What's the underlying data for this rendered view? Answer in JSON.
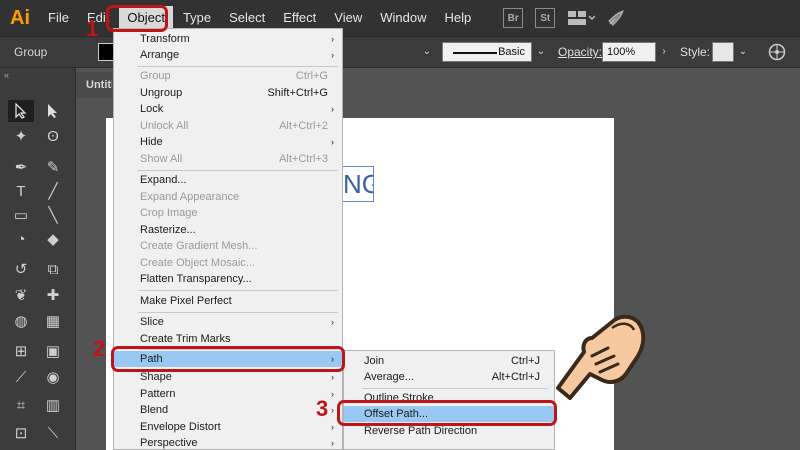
{
  "app": {
    "logo": "Ai"
  },
  "menubar": {
    "items": [
      "File",
      "Edit",
      "Object",
      "Type",
      "Select",
      "Effect",
      "View",
      "Window",
      "Help"
    ],
    "active": "Object",
    "icons": {
      "bridge": "Br",
      "stock": "St"
    }
  },
  "controlbar": {
    "selection_label": "Group",
    "stroke_style": "Basic",
    "opacity_label": "Opacity:",
    "opacity_value": "100%",
    "style_label": "Style:"
  },
  "document": {
    "tab_title": "Untitled",
    "canvas_text": "NG"
  },
  "object_menu": [
    {
      "label": "Transform",
      "submenu": true
    },
    {
      "label": "Arrange",
      "submenu": true
    },
    {
      "separator": true
    },
    {
      "label": "Group",
      "shortcut": "Ctrl+G",
      "disabled": true
    },
    {
      "label": "Ungroup",
      "shortcut": "Shift+Ctrl+G"
    },
    {
      "label": "Lock",
      "submenu": true
    },
    {
      "label": "Unlock All",
      "shortcut": "Alt+Ctrl+2",
      "disabled": true
    },
    {
      "label": "Hide",
      "submenu": true
    },
    {
      "label": "Show All",
      "shortcut": "Alt+Ctrl+3",
      "disabled": true
    },
    {
      "separator": true
    },
    {
      "label": "Expand..."
    },
    {
      "label": "Expand Appearance",
      "disabled": true
    },
    {
      "label": "Crop Image",
      "disabled": true
    },
    {
      "label": "Rasterize..."
    },
    {
      "label": "Create Gradient Mesh...",
      "disabled": true
    },
    {
      "label": "Create Object Mosaic...",
      "disabled": true
    },
    {
      "label": "Flatten Transparency..."
    },
    {
      "separator": true
    },
    {
      "label": "Make Pixel Perfect"
    },
    {
      "separator": true
    },
    {
      "label": "Slice",
      "submenu": true
    },
    {
      "label": "Create Trim Marks"
    },
    {
      "separator": true
    },
    {
      "label": "Path",
      "submenu": true,
      "highlighted": true
    },
    {
      "label": "Shape",
      "submenu": true
    },
    {
      "label": "Pattern",
      "submenu": true
    },
    {
      "label": "Blend",
      "submenu": true
    },
    {
      "label": "Envelope Distort",
      "submenu": true
    },
    {
      "label": "Perspective",
      "submenu": true
    }
  ],
  "path_submenu": [
    {
      "label": "Join",
      "shortcut": "Ctrl+J"
    },
    {
      "label": "Average...",
      "shortcut": "Alt+Ctrl+J"
    },
    {
      "separator": true
    },
    {
      "label": "Outline Stroke"
    },
    {
      "label": "Offset Path...",
      "highlighted": true
    },
    {
      "label": "Reverse Path Direction"
    }
  ],
  "annotations": {
    "step1": "1",
    "step2": "2",
    "step3": "3"
  },
  "colors": {
    "highlight": "#99c9f3",
    "annotation": "#c0141b",
    "logo": "#ff9a00"
  }
}
